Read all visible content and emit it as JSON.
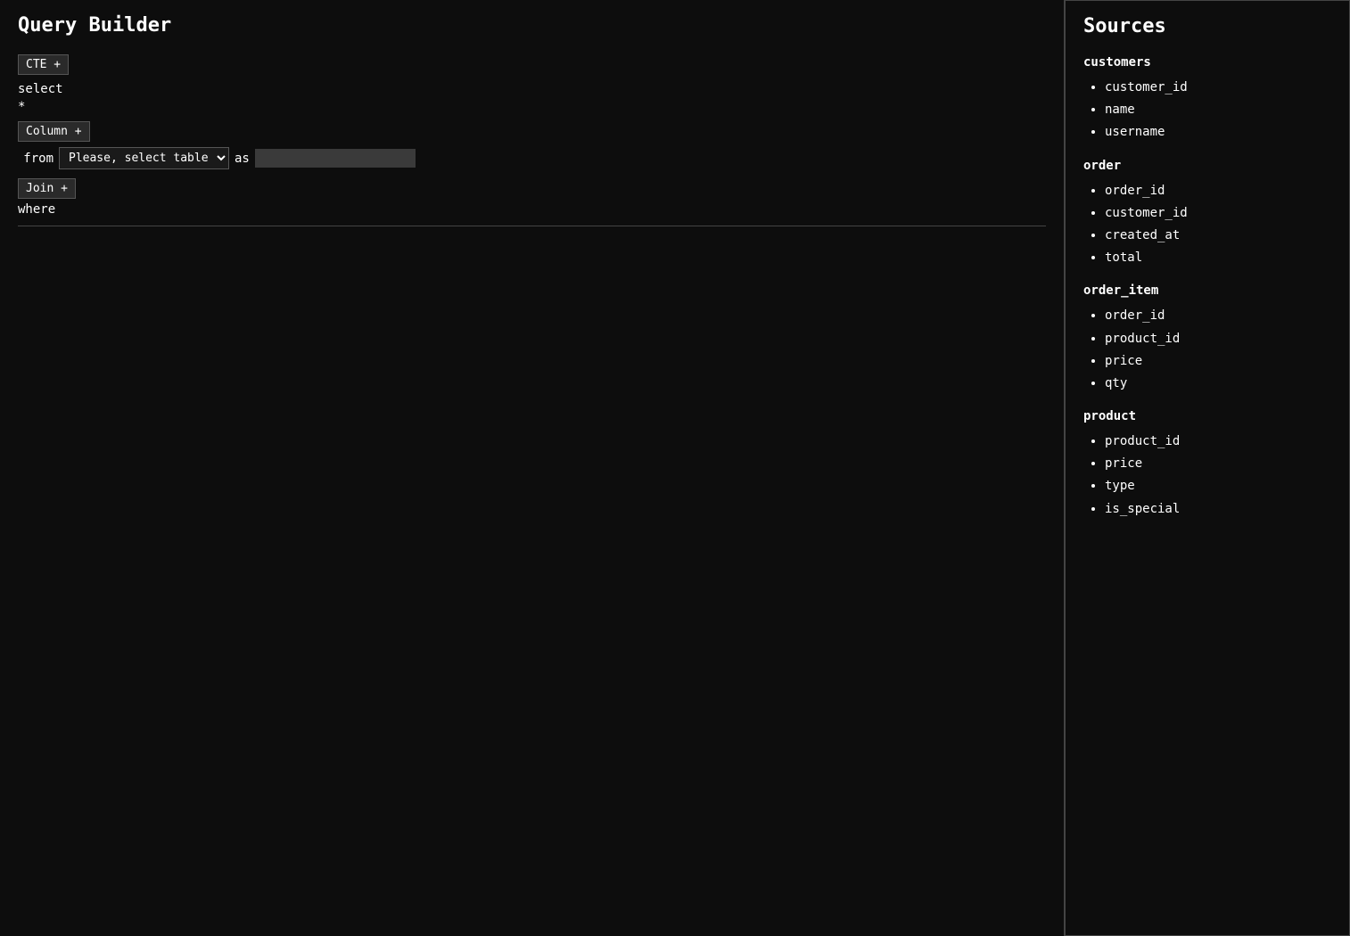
{
  "header": {
    "title": "Query Builder"
  },
  "queryBuilder": {
    "cte_button_label": "CTE +",
    "select_keyword": "select",
    "star": "*",
    "column_button_label": "Column +",
    "from_label": "from",
    "table_select_placeholder": "Please, select table",
    "as_label": "as",
    "alias_placeholder": "",
    "join_button_label": "Join +",
    "where_label": "where"
  },
  "sources": {
    "title": "Sources",
    "tables": [
      {
        "name": "customers",
        "fields": [
          "customer_id",
          "name",
          "username"
        ]
      },
      {
        "name": "order",
        "fields": [
          "order_id",
          "customer_id",
          "created_at",
          "total"
        ]
      },
      {
        "name": "order_item",
        "fields": [
          "order_id",
          "product_id",
          "price",
          "qty"
        ]
      },
      {
        "name": "product",
        "fields": [
          "product_id",
          "price",
          "type",
          "is_special"
        ]
      }
    ]
  }
}
